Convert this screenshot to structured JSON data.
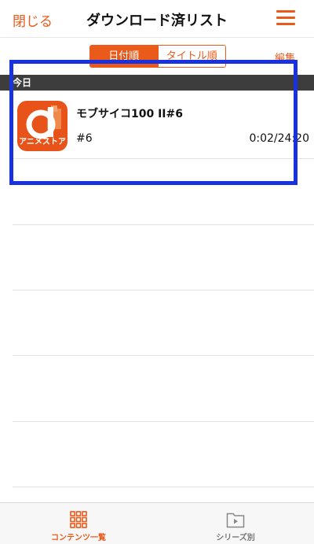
{
  "header": {
    "close_label": "閉じる",
    "title": "ダウンロード済リスト",
    "menu_icon": "hamburger-menu-icon"
  },
  "sort": {
    "options": [
      "日付順",
      "タイトル順"
    ],
    "selected": "日付順",
    "edit_label": "編集"
  },
  "sections": [
    {
      "header": "今日",
      "items": [
        {
          "thumbnail_label": "アニメストア",
          "title": "モブサイコ100 II#6",
          "episode": "#6",
          "duration": "0:02/24:20"
        }
      ]
    }
  ],
  "tabbar": {
    "tabs": [
      {
        "label": "コンテンツ一覧",
        "icon": "grid-icon",
        "active": true
      },
      {
        "label": "シリーズ別",
        "icon": "folder-play-icon",
        "active": false
      }
    ]
  },
  "colors": {
    "accent": "#ea5a1b",
    "section_bg": "#3d3d3d",
    "highlight_box": "#1932e0"
  }
}
